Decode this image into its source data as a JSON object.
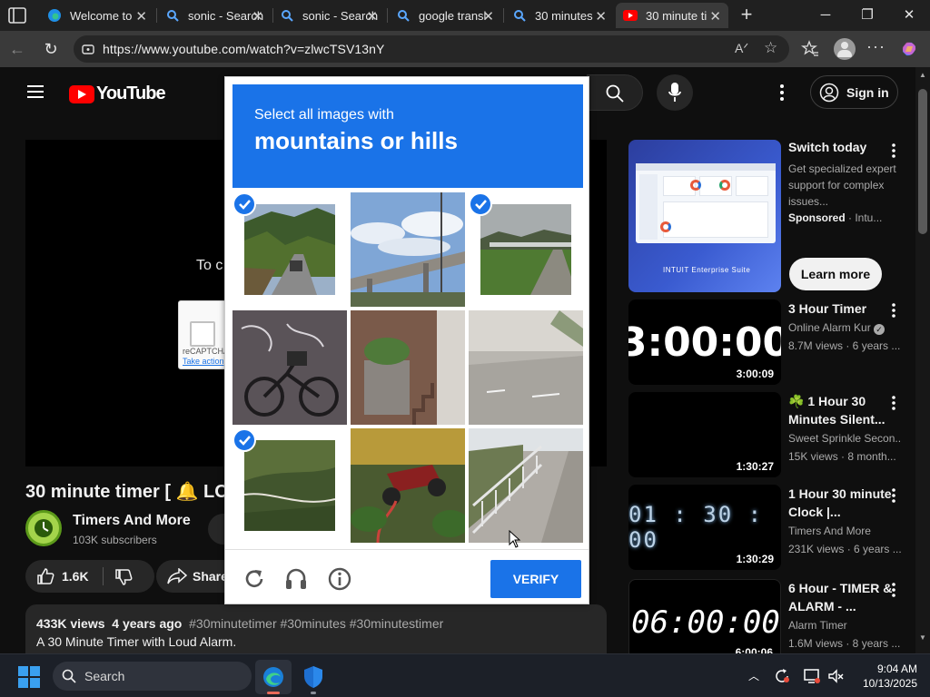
{
  "browser": {
    "tabs": [
      {
        "label": "Welcome to",
        "icon": "edge-icon",
        "active": false
      },
      {
        "label": "sonic - Search",
        "icon": "search-icon",
        "active": false
      },
      {
        "label": "sonic - Search",
        "icon": "search-icon",
        "active": false
      },
      {
        "label": "google transl",
        "icon": "search-icon",
        "active": false
      },
      {
        "label": "30 minutes",
        "icon": "search-icon",
        "active": false
      },
      {
        "label": "30 minute ti",
        "icon": "youtube-icon",
        "active": true
      }
    ],
    "url": "https://www.youtube.com/watch?v=zlwcTSV13nY"
  },
  "youtube": {
    "logo": "YouTube",
    "sign_in": "Sign in",
    "player_overlay_text": "To c",
    "mini_recaptcha": {
      "label": "reCAPTCHA",
      "action": "Take action"
    },
    "video_title": "30 minute timer [ 🔔 LOU",
    "channel": {
      "name": "Timers And More",
      "subscribers": "103K subscribers"
    },
    "likes": "1.6K",
    "share": "Share",
    "description": {
      "views": "433K views",
      "age": "4 years ago",
      "tags": "#30minutetimer #30minutes #30minutestimer",
      "text": "A 30 Minute Timer with Loud Alarm."
    },
    "ad": {
      "title": "Switch today",
      "description": "Get specialized expert support for complex issues...",
      "sponsored": "Sponsored",
      "advertiser": "Intu...",
      "brand": "INTUIT Enterprise Suite",
      "cta": "Learn more"
    },
    "recommendations": [
      {
        "title": "3 Hour Timer",
        "channel": "Online Alarm Kur",
        "meta": "8.7M views · 6 years ...",
        "duration": "3:00:09",
        "thumb_text": "3:00:00"
      },
      {
        "title": "☘️ 1 Hour 30 Minutes Silent...",
        "channel": "Sweet Sprinkle Secon...",
        "meta": "15K views · 8 month...",
        "duration": "1:30:27",
        "thumb_text": ""
      },
      {
        "title": "1 Hour 30 minute Clock |...",
        "channel": "Timers And More",
        "meta": "231K views · 6 years ...",
        "duration": "1:30:29",
        "thumb_text": "01 : 30 : 00"
      },
      {
        "title": "6 Hour - TIMER & ALARM - ...",
        "channel": "Alarm Timer",
        "meta": "1.6M views · 8 years ...",
        "duration": "6:00:06",
        "thumb_text": "06:00:00"
      }
    ]
  },
  "captcha": {
    "instruction": "Select all images with",
    "target": "mountains or hills",
    "tiles": [
      {
        "label": "road with trees and hills",
        "selected": true
      },
      {
        "label": "overpass and sky",
        "selected": false
      },
      {
        "label": "bridge over field with hills",
        "selected": true
      },
      {
        "label": "bicycle by wall",
        "selected": false
      },
      {
        "label": "stairs with plant",
        "selected": false
      },
      {
        "label": "paved path",
        "selected": false
      },
      {
        "label": "forested hillside",
        "selected": true
      },
      {
        "label": "motorcycle in garden",
        "selected": false
      },
      {
        "label": "sidewalk with railing",
        "selected": false
      }
    ],
    "verify": "VERIFY"
  },
  "taskbar": {
    "search": "Search",
    "time": "9:04 AM",
    "date": "10/13/2025"
  },
  "colors": {
    "captcha_blue": "#1a73e8",
    "youtube_red": "#ff0000",
    "page_bg": "#0f0f0f"
  }
}
